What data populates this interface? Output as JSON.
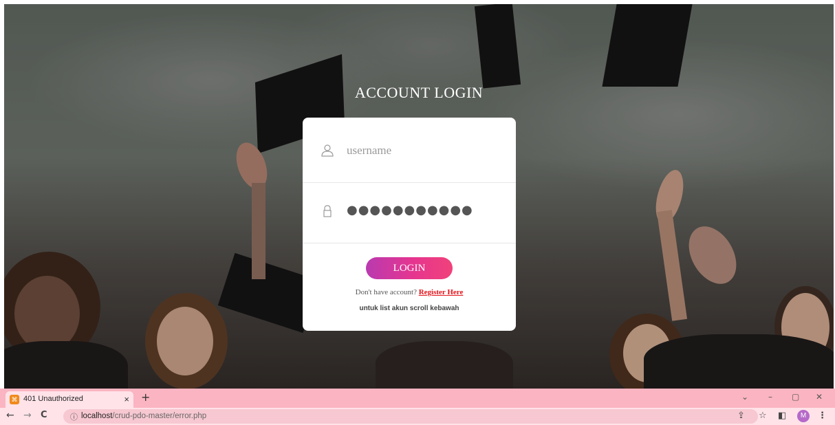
{
  "page": {
    "title": "ACCOUNT LOGIN"
  },
  "login": {
    "username_placeholder": "username",
    "password_value": "●●●●●●●●●●●",
    "button_label": "LOGIN",
    "register_prompt": "Don't have account?",
    "register_link": "Register Here",
    "hint": "untuk list akun scroll kebawah"
  },
  "browser": {
    "tab_title": "401 Unauthorized",
    "tab_close": "×",
    "new_tab": "+",
    "url_host": "localhost",
    "url_path": "/crud-pdo-master/error.php",
    "profile_initial": "M",
    "accent": "#fbb4c1",
    "nav": {
      "back": "←",
      "forward": "→",
      "reload": "C",
      "info": "ⓘ"
    },
    "window": {
      "dropdown": "⌄",
      "minimize": "–",
      "restore": "▢",
      "close": "✕"
    },
    "toolbar_icons": {
      "share": "⇪",
      "star": "☆",
      "sidepanel": "◧",
      "menu": "⋮"
    }
  }
}
